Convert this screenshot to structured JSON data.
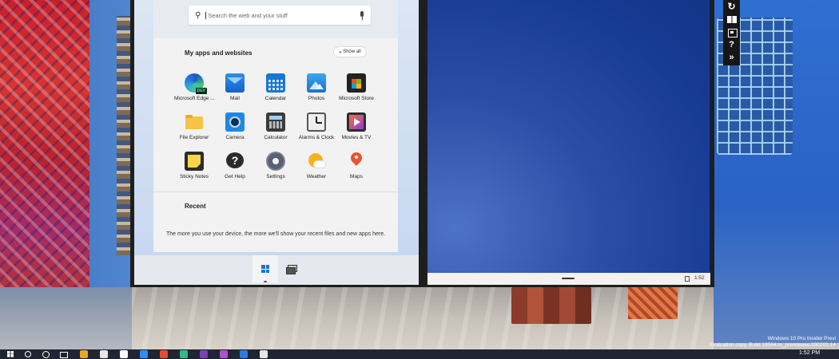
{
  "start_menu": {
    "search_placeholder": "Search the web and your stuff",
    "section_title": "My apps and websites",
    "show_all_label": "Show all",
    "apps": [
      {
        "label": "Microsoft Edge ...",
        "icon": "edge-dev-icon"
      },
      {
        "label": "Mail",
        "icon": "mail-icon"
      },
      {
        "label": "Calendar",
        "icon": "calendar-icon"
      },
      {
        "label": "Photos",
        "icon": "photos-icon"
      },
      {
        "label": "Microsoft Store",
        "icon": "store-icon"
      },
      {
        "label": "File Explorer",
        "icon": "folder-icon"
      },
      {
        "label": "Camera",
        "icon": "camera-icon"
      },
      {
        "label": "Calculator",
        "icon": "calculator-icon"
      },
      {
        "label": "Alarms & Clock",
        "icon": "clock-icon"
      },
      {
        "label": "Movies & TV",
        "icon": "movies-icon"
      },
      {
        "label": "Sticky Notes",
        "icon": "sticky-notes-icon"
      },
      {
        "label": "Get Help",
        "icon": "help-icon"
      },
      {
        "label": "Settings",
        "icon": "gear-icon"
      },
      {
        "label": "Weather",
        "icon": "weather-icon"
      },
      {
        "label": "Maps",
        "icon": "map-pin-icon"
      }
    ],
    "recent_title": "Recent",
    "recent_message": "The more you use your device, the more we'll show your recent files and new apps here."
  },
  "right_pane": {
    "clock": "1:52"
  },
  "emulator_toolbar": {
    "help_glyph": "?",
    "more_glyph": "»"
  },
  "desktop": {
    "watermark_line1": "Windows 10 Pro Insider Previ",
    "watermark_line2": "Evaluation copy. Build 19564.rs_prerelease.200202-14"
  },
  "taskbar": {
    "clock": "1:52 PM",
    "pinned_colors": [
      "#e8a628",
      "#e6e6e6",
      "#ffffff",
      "#2f8ff0",
      "#e54d32",
      "#31b88f",
      "#7d3fb4",
      "#b04fd1",
      "#2b7de0",
      "#e6e6e6"
    ]
  }
}
